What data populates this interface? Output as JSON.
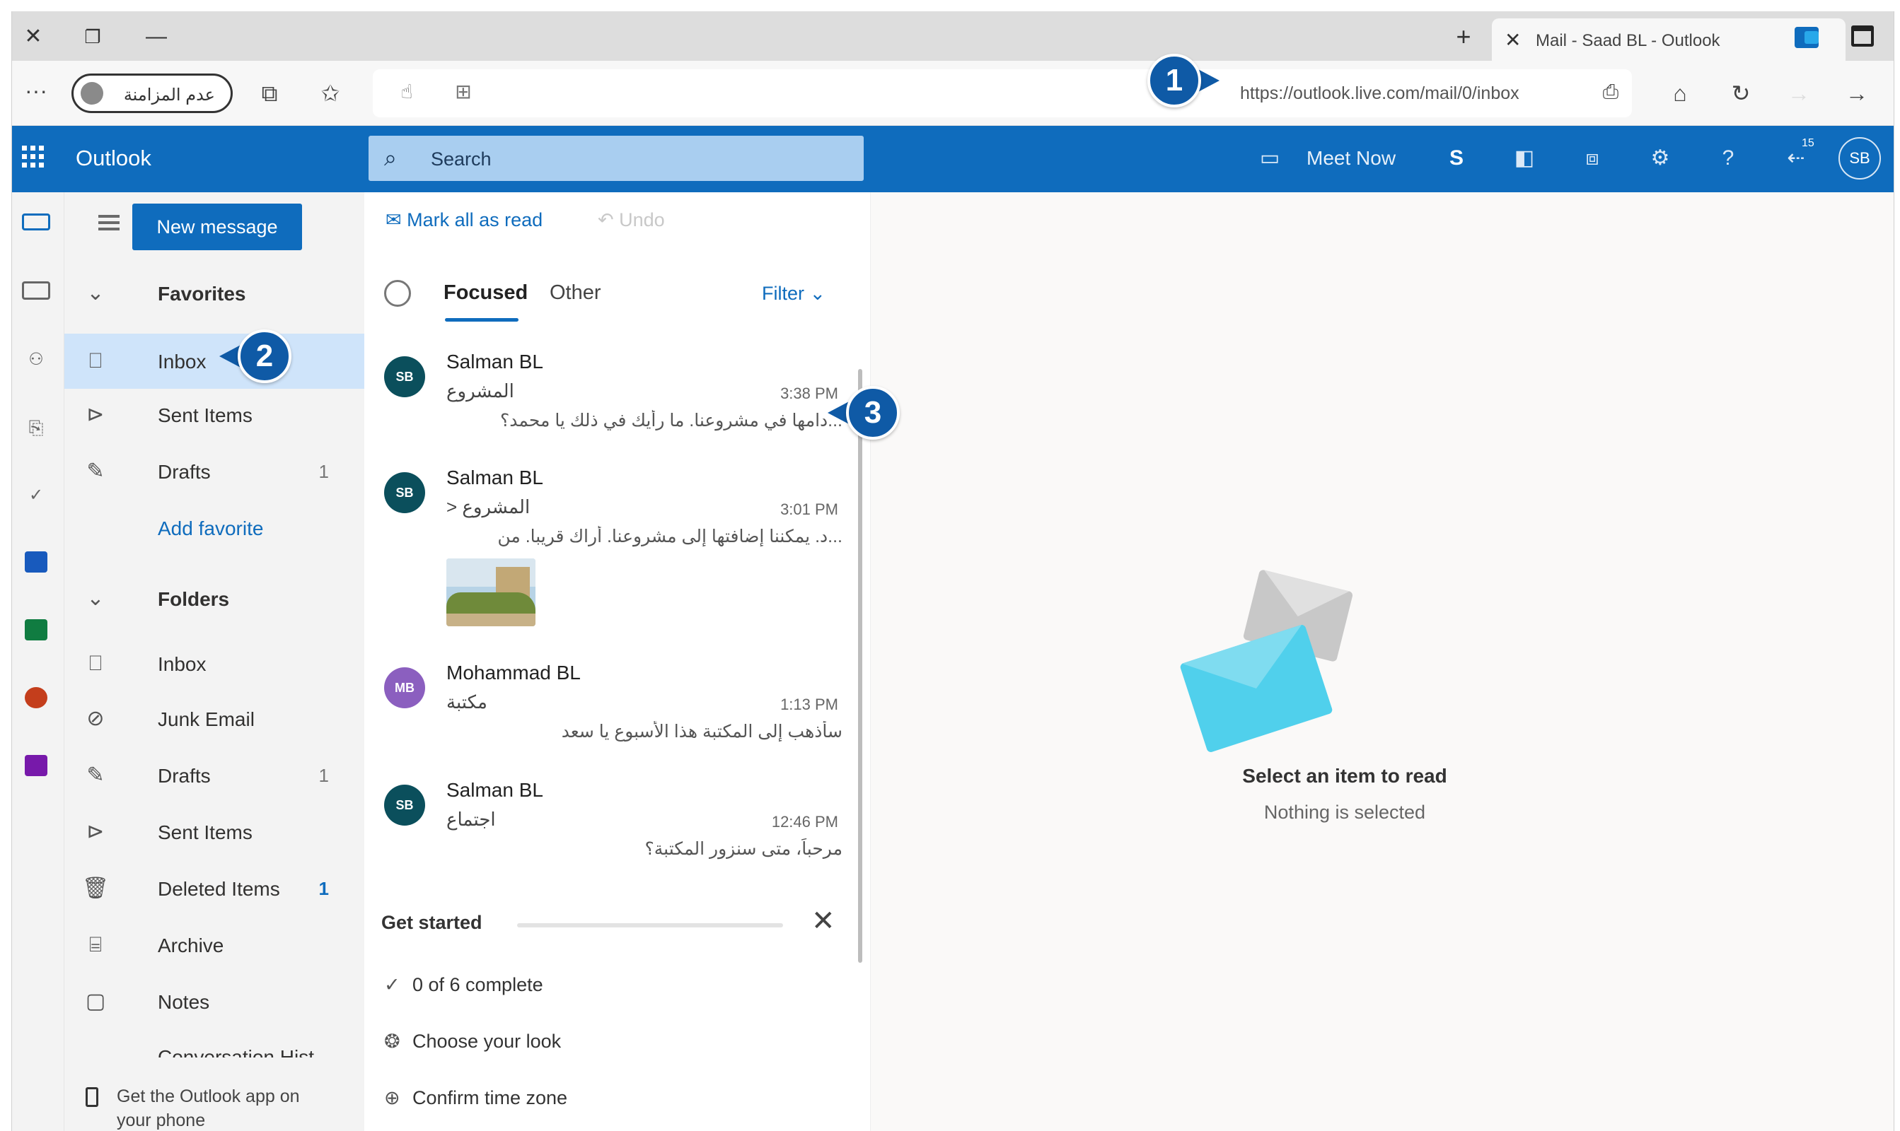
{
  "browser": {
    "tab_title": "Mail - Saad BL - Outlook",
    "url": "https://outlook.live.com/mail/0/inbox",
    "profile_label": "عدم المزامنة"
  },
  "header": {
    "app_name": "Outlook",
    "search_placeholder": "Search",
    "meet_now": "Meet Now",
    "avatar_initials": "SB",
    "notification_count": "15",
    "brand_color": "#0f6cbd"
  },
  "folder_pane": {
    "new_message": "New message",
    "favorites_heading": "Favorites",
    "favorites": [
      {
        "label": "Inbox",
        "count": ""
      },
      {
        "label": "Sent Items",
        "count": ""
      },
      {
        "label": "Drafts",
        "count": "1"
      }
    ],
    "add_favorite": "Add favorite",
    "folders_heading": "Folders",
    "folders": [
      {
        "label": "Inbox",
        "count": ""
      },
      {
        "label": "Junk Email",
        "count": ""
      },
      {
        "label": "Drafts",
        "count": "1"
      },
      {
        "label": "Sent Items",
        "count": ""
      },
      {
        "label": "Deleted Items",
        "count": "1"
      },
      {
        "label": "Archive",
        "count": ""
      },
      {
        "label": "Notes",
        "count": ""
      },
      {
        "label": "Conversation Hist",
        "count": ""
      }
    ],
    "get_app": "Get the Outlook app on your phone"
  },
  "message_list": {
    "mark_all_read": "Mark all as read",
    "undo": "Undo",
    "tab_focused": "Focused",
    "tab_other": "Other",
    "filter": "Filter",
    "messages": [
      {
        "initials": "SB",
        "sender": "Salman BL",
        "subject": "المشروع",
        "time": "3:38 PM",
        "preview": "...دامها في مشروعنا. ما رأيك في ذلك يا محمد؟",
        "avatar_color": "#0b4f5c"
      },
      {
        "initials": "SB",
        "sender": "Salman BL",
        "subject": "المشروع <",
        "time": "3:01 PM",
        "preview": "...د. يمكننا إضافتها إلى مشروعنا. أراك قريبا. من",
        "avatar_color": "#0b4f5c"
      },
      {
        "initials": "MB",
        "sender": "Mohammad BL",
        "subject": "مكتبة",
        "time": "1:13 PM",
        "preview": "سأذهب إلى المكتبة هذا الأسبوع يا سعد",
        "avatar_color": "#8b5fbf"
      },
      {
        "initials": "SB",
        "sender": "Salman BL",
        "subject": "اجتماع",
        "time": "12:46 PM",
        "preview": "مرحباً، متى سنزور المكتبة؟",
        "avatar_color": "#0b4f5c"
      }
    ],
    "get_started": {
      "title": "Get started",
      "items": [
        "0 of 6 complete",
        "Choose your look",
        "Confirm time zone"
      ]
    }
  },
  "reading_pane": {
    "title": "Select an item to read",
    "subtitle": "Nothing is selected"
  },
  "callouts": [
    "1",
    "2",
    "3"
  ]
}
